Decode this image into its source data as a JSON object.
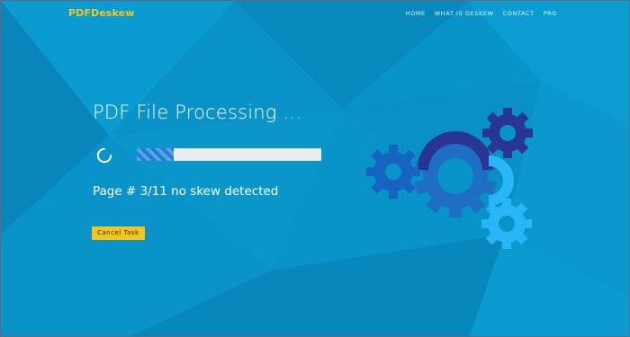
{
  "header": {
    "brand": "PDFDeskew",
    "nav": [
      "HOME",
      "WHAT IS DESKEW",
      "CONTACT",
      "PRO"
    ]
  },
  "main": {
    "title": "PDF File Processing ...",
    "status": "Page # 3/11 no skew detected",
    "cancel_label": "Cancel Task",
    "progress": 0.2
  },
  "icons": {
    "spinner": "loading-spinner-icon",
    "gears": "gears-illustration"
  },
  "colors": {
    "background": "#0894c9",
    "brand": "#f5c518",
    "button": "#f5c518",
    "progress_fill": "#1e7fd8",
    "gear_dark": "#283593",
    "gear_mid": "#1565c0",
    "gear_light": "#29b6f6"
  }
}
